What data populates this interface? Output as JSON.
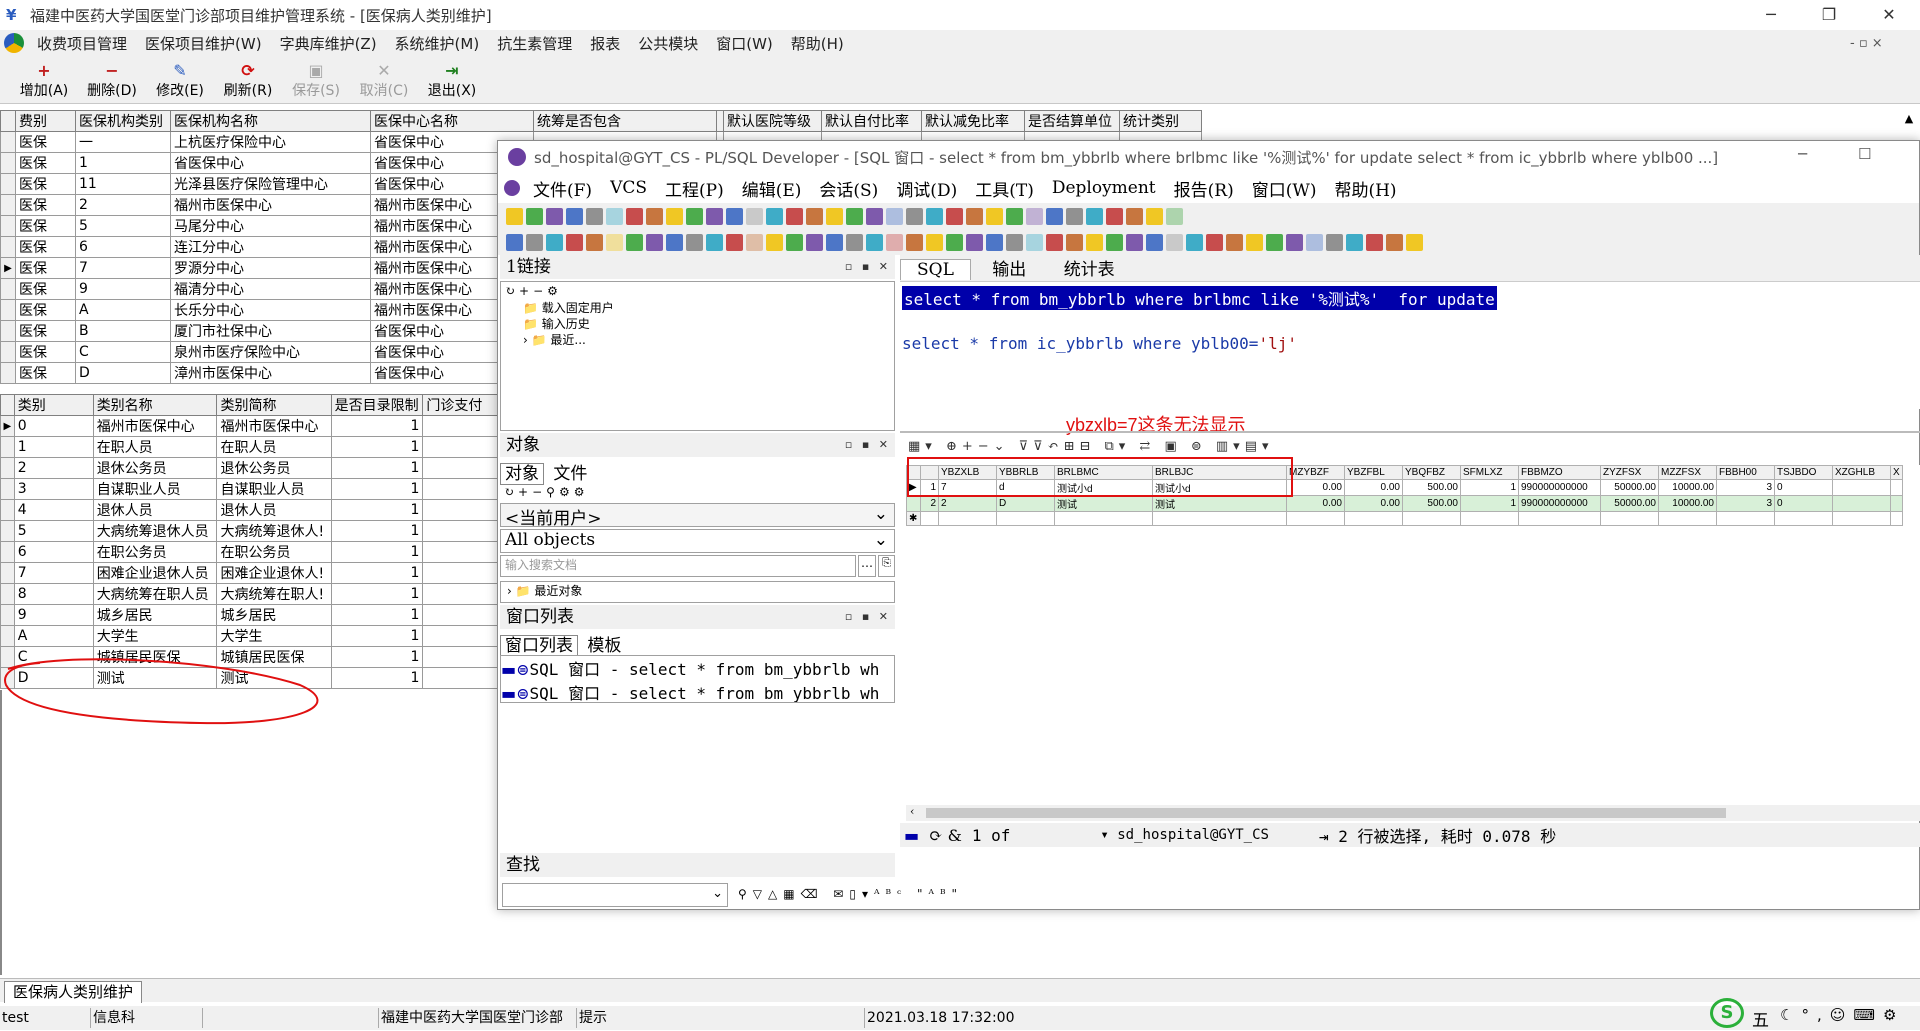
{
  "app": {
    "title": "福建中医药大学国医堂门诊部项目维护管理系统 - [医保病人类别维护]",
    "controls": {
      "minimize": "─",
      "restore": "❐",
      "close": "✕",
      "mdi": "- ▫ ×"
    }
  },
  "menu": [
    "收费项目管理",
    "医保项目维护(W)",
    "字典库维护(Z)",
    "系统维护(M)",
    "抗生素管理",
    "报表",
    "公共模块",
    "窗口(W)",
    "帮助(H)"
  ],
  "toolbar": [
    {
      "label": "增加(A)",
      "icon": "plus-icon",
      "glyph": "+",
      "color": "#c02020",
      "disabled": false
    },
    {
      "label": "删除(D)",
      "icon": "minus-icon",
      "glyph": "−",
      "color": "#c02020",
      "disabled": false
    },
    {
      "label": "修改(E)",
      "icon": "edit-icon",
      "glyph": "✎",
      "color": "#2a5cbf",
      "disabled": false
    },
    {
      "label": "刷新(R)",
      "icon": "refresh-icon",
      "glyph": "⟳",
      "color": "#d01010",
      "disabled": false
    },
    {
      "label": "保存(S)",
      "icon": "save-icon",
      "glyph": "▣",
      "color": "#aaaaaa",
      "disabled": true
    },
    {
      "label": "取消(C)",
      "icon": "cancel-icon",
      "glyph": "✕",
      "color": "#aaaaaa",
      "disabled": true
    },
    {
      "label": "退出(X)",
      "icon": "exit-icon",
      "glyph": "⇥",
      "color": "#208020",
      "disabled": false
    }
  ],
  "top_grid": {
    "headers": [
      "费别",
      "医保机构类别",
      "医保机构名称",
      "医保中心名称",
      "统筹是否包含",
      "",
      "默认医院等级",
      "默认自付比率",
      "默认减免比率",
      "是否结算单位",
      "统计类别"
    ],
    "rows": [
      [
        "医保",
        "一",
        "上杭医疗保险中心",
        "省医保中心"
      ],
      [
        "医保",
        "1",
        "省医保中心",
        "省医保中心"
      ],
      [
        "医保",
        "11",
        "光泽县医疗保险管理中心",
        "省医保中心"
      ],
      [
        "医保",
        "2",
        "福州市医保中心",
        "福州市医保中心"
      ],
      [
        "医保",
        "5",
        "马尾分中心",
        "福州市医保中心"
      ],
      [
        "医保",
        "6",
        "连江分中心",
        "福州市医保中心"
      ],
      [
        "医保",
        "7",
        "罗源分中心",
        "福州市医保中心"
      ],
      [
        "医保",
        "9",
        "福清分中心",
        "福州市医保中心"
      ],
      [
        "医保",
        "A",
        "长乐分中心",
        "福州市医保中心"
      ],
      [
        "医保",
        "B",
        "厦门市社保中心",
        "省医保中心"
      ],
      [
        "医保",
        "C",
        "泉州市医疗保险中心",
        "省医保中心"
      ],
      [
        "医保",
        "D",
        "漳州市医保中心",
        "省医保中心"
      ]
    ],
    "current_row": 6
  },
  "bottom_grid": {
    "headers": [
      "类别",
      "类别名称",
      "类别简称",
      "是否目录限制",
      "门诊支付"
    ],
    "rows": [
      [
        "0",
        "福州市医保中心",
        "福州市医保中心",
        "1"
      ],
      [
        "1",
        "在职人员",
        "在职人员",
        "1"
      ],
      [
        "2",
        "退休公务员",
        "退休公务员",
        "1"
      ],
      [
        "3",
        "自谋职业人员",
        "自谋职业人员",
        "1"
      ],
      [
        "4",
        "退休人员",
        "退休人员",
        "1"
      ],
      [
        "5",
        "大病统筹退休人员",
        "大病统筹退休人!",
        "1"
      ],
      [
        "6",
        "在职公务员",
        "在职公务员",
        "1"
      ],
      [
        "7",
        "困难企业退休人员",
        "困难企业退休人!",
        "1"
      ],
      [
        "8",
        "大病统筹在职人员",
        "大病统筹在职人!",
        "1"
      ],
      [
        "9",
        "城乡居民",
        "城乡居民",
        "1"
      ],
      [
        "A",
        "大学生",
        "大学生",
        "1"
      ],
      [
        "C",
        "城镇居民医保",
        "城镇居民医保",
        "1"
      ],
      [
        "D",
        "测试",
        "测试",
        "1"
      ]
    ]
  },
  "bottom_tab": "医保病人类别维护",
  "status": {
    "user": "test",
    "dept": "信息科",
    "org": "福建中医药大学国医堂门诊部",
    "hint": "提示",
    "datetime": "2021.03.18  17:32:00"
  },
  "plsql": {
    "title": "sd_hospital@GYT_CS - PL/SQL Developer - [SQL 窗口 - select * from bm_ybbrlb where brlbmc like '%测试%' for update select * from ic_ybbrlb where yblb00 ...]",
    "menu": [
      "文件(F)",
      "VCS",
      "工程(P)",
      "编辑(E)",
      "会话(S)",
      "调试(D)",
      "工具(T)",
      "Deployment",
      "报告(R)",
      "窗口(W)",
      "帮助(H)"
    ],
    "connect_panel": {
      "title": "1链接",
      "items": [
        "载入固定用户",
        "输入历史",
        "最近..."
      ]
    },
    "objects_panel": {
      "title": "对象",
      "tabs": [
        "对象",
        "文件"
      ],
      "user": "<当前用户>",
      "filter": "All objects",
      "search_placeholder": "输入搜索文档",
      "recent": "最近对象"
    },
    "windows_panel": {
      "title": "窗口列表",
      "tabs": [
        "窗口列表",
        "模板"
      ],
      "items": [
        "SQL 窗口 - select * from bm_ybbrlb wh",
        "SQL 窗口 - select * from bm_ybbrlb wh"
      ]
    },
    "find_panel": {
      "title": "查找"
    },
    "editor": {
      "tabs": [
        "SQL",
        "输出",
        "统计表"
      ],
      "line1": [
        "select",
        " * ",
        "from",
        " bm_ybbrlb ",
        "where",
        " brlbmc ",
        "like",
        " ",
        "'%测试%'",
        "  ",
        "for update"
      ],
      "line2": [
        "select",
        " * ",
        "from",
        " ic_ybbrlb ",
        "where",
        " yblb00=",
        "'lj'"
      ]
    },
    "annotation": "ybzxlb=7这条无法显示",
    "result": {
      "headers": [
        "",
        "YBZXLB",
        "YBBRLB",
        "BRLBMC",
        "BRLBJC",
        "MZYBZF",
        "YBZFBL",
        "YBQFBZ",
        "SFMLXZ",
        "FBBMZO",
        "ZYZFSX",
        "MZZFSX",
        "FBBH00",
        "TSJBDO",
        "XZGHLB",
        "X"
      ],
      "rows": [
        [
          "1",
          "7",
          "d",
          "测试小d",
          "测试小d",
          "0.00",
          "0.00",
          "500.00",
          "1",
          "990000000000",
          "50000.00",
          "10000.00",
          "3",
          "0",
          "",
          ""
        ],
        [
          "2",
          "2",
          "D",
          "测试",
          "测试",
          "0.00",
          "0.00",
          "500.00",
          "1",
          "990000000000",
          "50000.00",
          "10000.00",
          "3",
          "0",
          "",
          ""
        ]
      ]
    },
    "status": {
      "record": "1 of",
      "conn": "sd_hospital@GYT_CS",
      "info": "2 行被选择, 耗时 0.078 秒"
    }
  },
  "tray": {
    "ime": "五"
  },
  "colors": {
    "highlight": "#0000aa",
    "annotation_red": "#e01010",
    "green_row": "#d8f0d8"
  }
}
